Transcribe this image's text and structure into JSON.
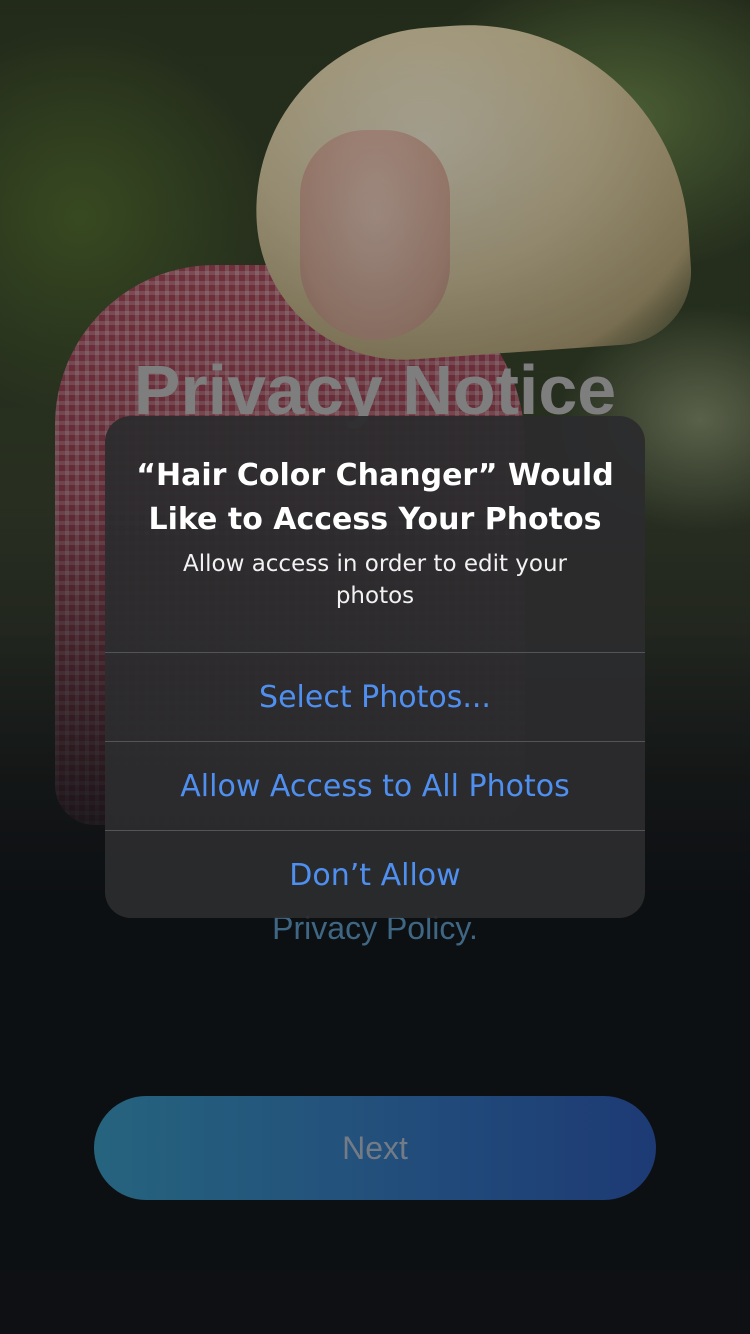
{
  "page": {
    "title": "Privacy Notice",
    "policy_link": "Privacy Policy",
    "policy_suffix": ".",
    "next_label": "Next"
  },
  "alert": {
    "title": "“Hair Color Changer” Would Like to Access Your Photos",
    "message": "Allow access in order to edit your photos",
    "buttons": {
      "select_photos": "Select Photos...",
      "allow_all": "Allow Access to All Photos",
      "dont_allow": "Don’t Allow"
    }
  },
  "colors": {
    "accent_blue": "#4f8ff0",
    "alert_background": "#2c2c2e",
    "next_gradient_start": "#2f7a9a",
    "next_gradient_end": "#24478e"
  }
}
